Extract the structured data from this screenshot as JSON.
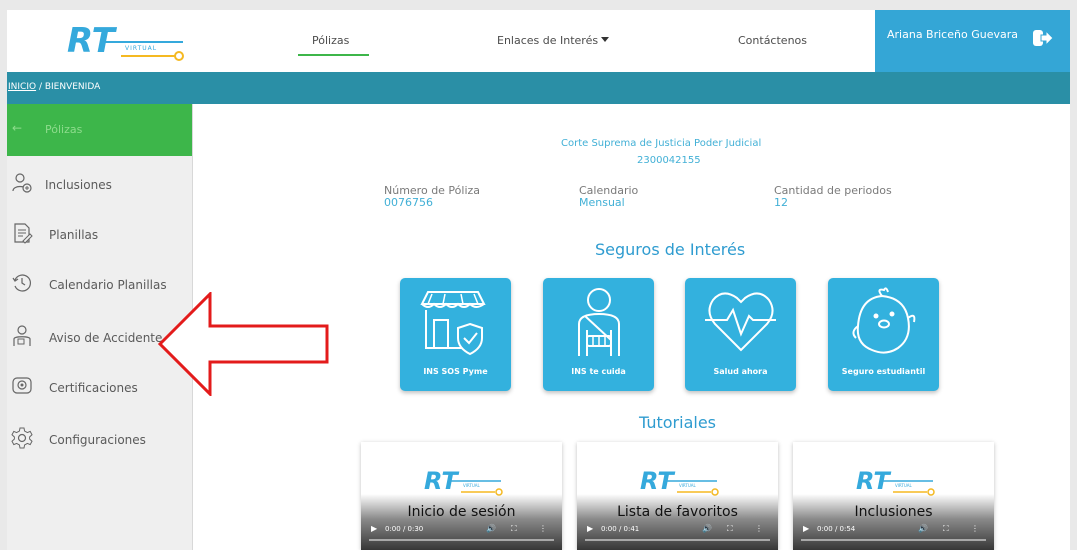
{
  "topnav": {
    "logo_text": "RT",
    "logo_sub": "VIRTUAL",
    "links": [
      {
        "label": "Pólizas"
      },
      {
        "label": "Enlaces de Interés"
      },
      {
        "label": "Contáctenos"
      }
    ],
    "user_name": "Ariana Briceño Guevara"
  },
  "breadcrumb": {
    "home": "INICIO",
    "separator": " / ",
    "current": "BIENVENIDA"
  },
  "sidebar": {
    "header_label": "Pólizas",
    "items": [
      {
        "label": "Inclusiones",
        "icon": "user-add-icon"
      },
      {
        "label": "Planillas",
        "icon": "document-edit-icon"
      },
      {
        "label": "Calendario Planillas",
        "icon": "history-clock-icon"
      },
      {
        "label": "Aviso de Accidente",
        "icon": "injured-person-icon"
      },
      {
        "label": "Certificaciones",
        "icon": "certificate-icon"
      },
      {
        "label": "Configuraciones",
        "icon": "gear-icon"
      }
    ]
  },
  "policy": {
    "organization": "Corte Suprema de Justicia Poder Judicial",
    "org_number": "2300042155",
    "fields": [
      {
        "label": "Número de Póliza",
        "value": "0076756"
      },
      {
        "label": "Calendario",
        "value": "Mensual"
      },
      {
        "label": "Cantidad de periodos",
        "value": "12"
      }
    ]
  },
  "insurance": {
    "title": "Seguros de Interés",
    "cards": [
      {
        "label": "INS SOS Pyme",
        "icon": "storefront-shield-icon"
      },
      {
        "label": "INS te cuida",
        "icon": "person-arm-sling-icon"
      },
      {
        "label": "Salud ahora",
        "icon": "heart-pulse-icon"
      },
      {
        "label": "Seguro estudiantil",
        "icon": "chick-mascot-icon"
      }
    ]
  },
  "tutorials": {
    "title": "Tutoriales",
    "videos": [
      {
        "title": "Inicio de sesión",
        "time": "0:00 / 0:30"
      },
      {
        "title": "Lista de favoritos",
        "time": "0:00 / 0:41"
      },
      {
        "title": "Inclusiones",
        "time": "0:00 / 0:54"
      }
    ]
  },
  "colors": {
    "brand_blue": "#34a6d6",
    "brand_green": "#3db64a",
    "crumb_teal": "#2a8fa6",
    "logo_yellow": "#f5b921",
    "annotation_red": "#e31b1b"
  }
}
